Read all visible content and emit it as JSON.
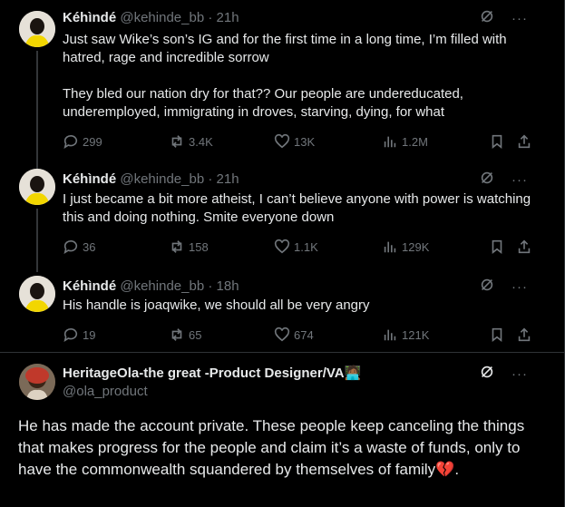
{
  "tweets": [
    {
      "name": "Kéhìndé",
      "handle": "@kehinde_bb",
      "time": "21h",
      "paragraphs": [
        "Just saw Wike’s son’s IG and for the first time in a long time, I’m filled with hatred, rage and incredible sorrow",
        "They bled our nation dry for that?? Our people are undereducated, underemployed, immigrating in droves, starving, dying, for what"
      ],
      "replies": "299",
      "reposts": "3.4K",
      "likes": "13K",
      "views": "1.2M"
    },
    {
      "name": "Kéhìndé",
      "handle": "@kehinde_bb",
      "time": "21h",
      "paragraphs": [
        "I just became a bit more atheist, I can’t believe anyone with power is watching this and doing nothing. Smite everyone down"
      ],
      "replies": "36",
      "reposts": "158",
      "likes": "1.1K",
      "views": "129K"
    },
    {
      "name": "Kéhìndé",
      "handle": "@kehinde_bb",
      "time": "18h",
      "paragraphs": [
        "His handle is joaqwike, we should all be very angry"
      ],
      "replies": "19",
      "reposts": "65",
      "likes": "674",
      "views": "121K"
    }
  ],
  "main": {
    "name": "HeritageOla-the great -Product Designer/VA🧑🏾‍💻",
    "handle": "@ola_product",
    "text": "He has made the account private. These people keep canceling the things that makes progress for the people and claim it’s a waste of funds, only to have the commonwealth squandered by themselves of family💔."
  },
  "colors": {
    "background": "#000000",
    "text": "#e7e9ea",
    "muted": "#71767b",
    "divider": "#2f3336"
  },
  "icons": [
    "grok-icon",
    "more-icon",
    "reply-icon",
    "repost-icon",
    "like-icon",
    "views-icon",
    "bookmark-icon",
    "share-icon"
  ]
}
